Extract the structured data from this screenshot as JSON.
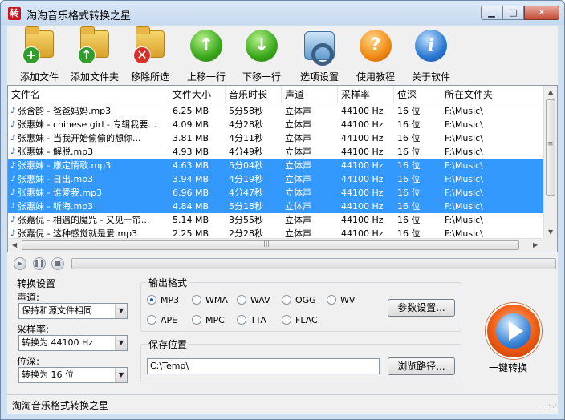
{
  "window": {
    "app_icon_text": "转",
    "title": "淘淘音乐格式转换之星",
    "min_glyph": "▁",
    "max_glyph": "□",
    "close_glyph": "✕"
  },
  "toolbar": {
    "add_file": {
      "label": "添加文件",
      "icon": "add-file-icon",
      "badge": "+"
    },
    "add_folder": {
      "label": "添加文件夹",
      "icon": "add-folder-icon",
      "badge": "↑"
    },
    "remove_selected": {
      "label": "移除所选",
      "icon": "remove-icon",
      "badge": "✕"
    },
    "move_up": {
      "label": "上移一行",
      "icon": "arrow-up-icon",
      "glyph": "↑"
    },
    "move_down": {
      "label": "下移一行",
      "icon": "arrow-down-icon",
      "glyph": "↓"
    },
    "options": {
      "label": "选项设置",
      "icon": "settings-icon"
    },
    "tutorial": {
      "label": "使用教程",
      "icon": "help-icon",
      "glyph": "?"
    },
    "about": {
      "label": "关于软件",
      "icon": "info-icon",
      "glyph": "i"
    }
  },
  "file_list": {
    "columns": [
      "文件名",
      "文件大小",
      "音乐时长",
      "声道",
      "采样率",
      "位深",
      "所在文件夹"
    ],
    "rows": [
      {
        "name": "张含韵 - 爸爸妈妈.mp3",
        "size": "6.25 MB",
        "duration": "5分58秒",
        "channel": "立体声",
        "rate": "44100 Hz",
        "depth": "16 位",
        "folder": "F:\\Music\\",
        "selected": false
      },
      {
        "name": "张惠妹 - chinese girl - 专辑我要...",
        "size": "4.09 MB",
        "duration": "4分28秒",
        "channel": "立体声",
        "rate": "44100 Hz",
        "depth": "16 位",
        "folder": "F:\\Music\\",
        "selected": false
      },
      {
        "name": "张惠妹 - 当我开始偷偷的想你...",
        "size": "3.81 MB",
        "duration": "4分11秒",
        "channel": "立体声",
        "rate": "44100 Hz",
        "depth": "16 位",
        "folder": "F:\\Music\\",
        "selected": false
      },
      {
        "name": "张惠妹 - 解脱.mp3",
        "size": "4.93 MB",
        "duration": "4分49秒",
        "channel": "立体声",
        "rate": "44100 Hz",
        "depth": "16 位",
        "folder": "F:\\Music\\",
        "selected": false
      },
      {
        "name": "张惠妹 - 康定情歌.mp3",
        "size": "4.63 MB",
        "duration": "5分04秒",
        "channel": "立体声",
        "rate": "44100 Hz",
        "depth": "16 位",
        "folder": "F:\\Music\\",
        "selected": true
      },
      {
        "name": "张惠妹 - 日出.mp3",
        "size": "3.94 MB",
        "duration": "4分19秒",
        "channel": "立体声",
        "rate": "44100 Hz",
        "depth": "16 位",
        "folder": "F:\\Music\\",
        "selected": true
      },
      {
        "name": "张惠妹 - 谁爱我.mp3",
        "size": "6.96 MB",
        "duration": "4分47秒",
        "channel": "立体声",
        "rate": "44100 Hz",
        "depth": "16 位",
        "folder": "F:\\Music\\",
        "selected": true
      },
      {
        "name": "张惠妹 - 听海.mp3",
        "size": "4.84 MB",
        "duration": "5分18秒",
        "channel": "立体声",
        "rate": "44100 Hz",
        "depth": "16 位",
        "folder": "F:\\Music\\",
        "selected": true
      },
      {
        "name": "张嘉倪 - 相遇的魔咒 - 又见一帘...",
        "size": "5.14 MB",
        "duration": "3分55秒",
        "channel": "立体声",
        "rate": "44100 Hz",
        "depth": "16 位",
        "folder": "F:\\Music\\",
        "selected": false
      },
      {
        "name": "张嘉倪 - 这种感觉就是爱.mp3",
        "size": "2.25 MB",
        "duration": "2分28秒",
        "channel": "立体声",
        "rate": "44100 Hz",
        "depth": "16 位",
        "folder": "F:\\Music\\",
        "selected": false
      }
    ],
    "note_glyph": "♪",
    "hscroll_grip": "|||",
    "vscroll_grip": "≡"
  },
  "player": {
    "play_glyph": "▶",
    "pause_glyph": "❚❚",
    "stop_glyph": "■"
  },
  "convert_settings": {
    "title": "转换设置",
    "channel_label": "声道:",
    "channel_value": "保持和源文件相同",
    "rate_label": "采样率:",
    "rate_value": "转换为 44100 Hz",
    "depth_label": "位深:",
    "depth_value": "转换为 16 位",
    "dropdown_glyph": "▼"
  },
  "output_format": {
    "title": "输出格式",
    "formats": [
      "MP3",
      "WMA",
      "WAV",
      "OGG",
      "WV",
      "APE",
      "MPC",
      "TTA",
      "FLAC"
    ],
    "selected": "MP3",
    "params_button": "参数设置..."
  },
  "save_location": {
    "title": "保存位置",
    "path": "C:\\Temp\\",
    "browse_button": "浏览路径..."
  },
  "convert_button": {
    "label": "一键转换"
  },
  "statusbar": {
    "text": "淘淘音乐格式转换之星"
  }
}
